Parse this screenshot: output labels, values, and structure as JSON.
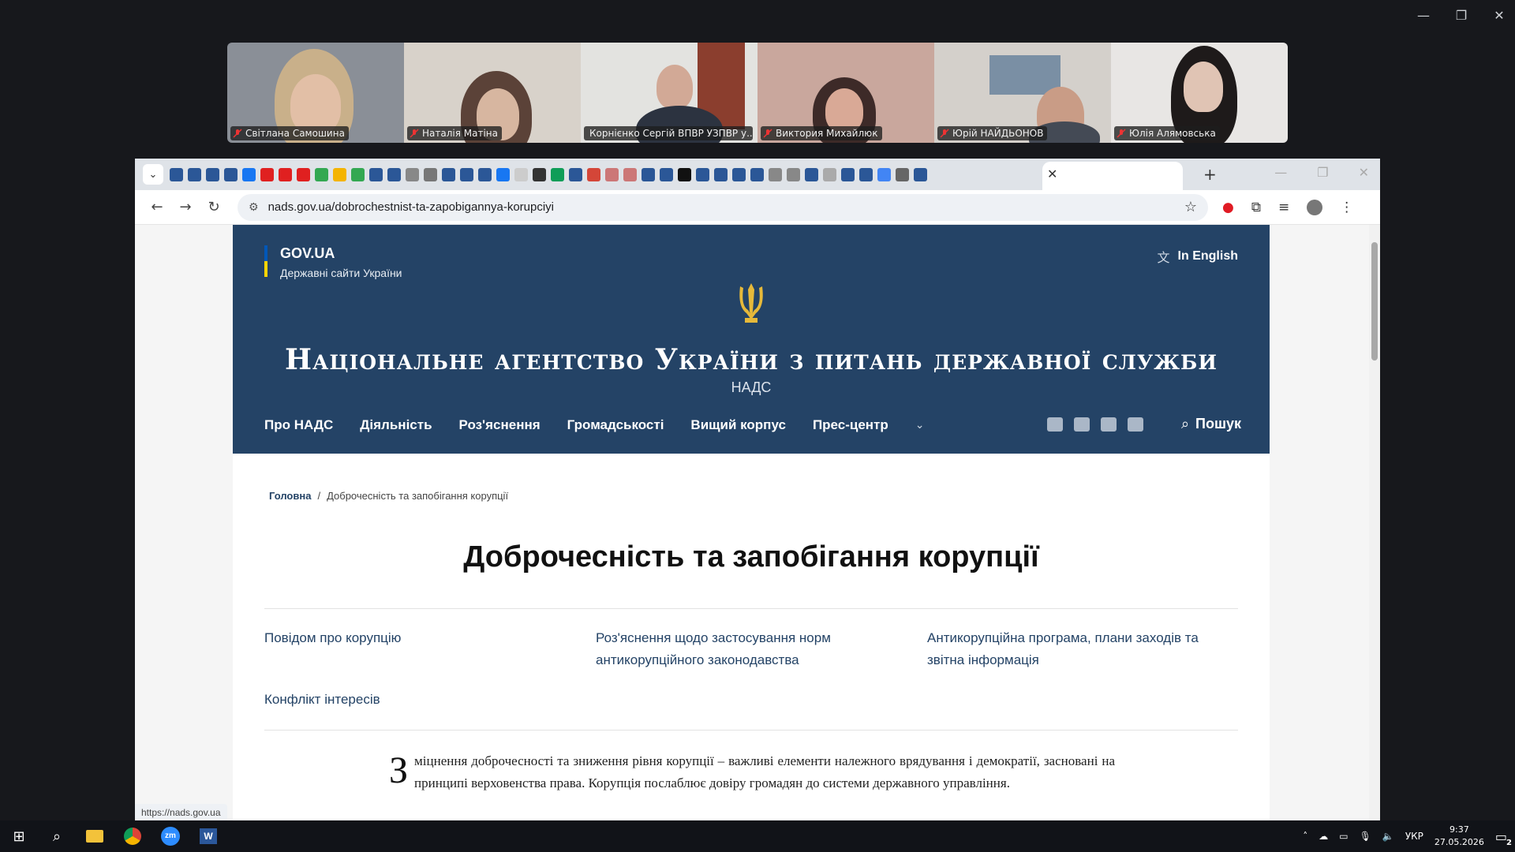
{
  "window_controls": [
    "—",
    "❐",
    "✕"
  ],
  "participants": [
    {
      "name": "Світлана Самошина",
      "bg": "#8a8f97"
    },
    {
      "name": "Наталія Матіна",
      "bg": "#c9c3bb"
    },
    {
      "name": "Корнієнко Сергій ВПВР УЗПВР у...",
      "bg": "#d9d9d6"
    },
    {
      "name": "Виктория Михайлюк",
      "bg": "#c6a59a"
    },
    {
      "name": "Юрій НАЙДЬОНОВ",
      "bg": "#cfcbc6"
    },
    {
      "name": "Юлія Алямовська",
      "bg": "#e6e4e3"
    }
  ],
  "browser": {
    "url": "nads.gov.ua/dobrochestnist-ta-zapobigannya-korupciyi",
    "status_url": "https://nads.gov.ua",
    "new_tab": "+",
    "close_tab": "✕"
  },
  "site": {
    "gov_title": "GOV.UA",
    "gov_subtitle": "Державні сайти України",
    "lang_link": "In English",
    "title": "Національне агентство України з питань державної служби",
    "abbr": "НАДС",
    "nav": [
      "Про НАДС",
      "Діяльність",
      "Роз'яснення",
      "Громадськості",
      "Вищий корпус",
      "Прес-центр"
    ],
    "search_label": "Пошук"
  },
  "breadcrumb": {
    "home": "Головна",
    "separator": "/",
    "current": "Доброчесність та запобігання корупції"
  },
  "page_title": "Доброчесність та запобігання корупції",
  "links": [
    "Повідом про корупцію",
    "Роз'яснення щодо застосування норм антикорупційного законодавства",
    "Антикорупційна програма, плани заходів та звітна інформація",
    "Конфлікт інтересів"
  ],
  "intro": {
    "dropcap": "З",
    "text": "міцнення доброчесності та зниження рівня корупції – важливі елементи належного врядування і демократії, засновані на принципі верховенства права. Корупція послаблює довіру громадян до системи державного управління."
  },
  "taskbar": {
    "language": "УКР",
    "time": "9:37",
    "date": "27.05.2026",
    "notifications": "2"
  },
  "colors": {
    "hero_bg": "#244366",
    "link": "#244366",
    "flag_blue": "#0057b8",
    "flag_yellow": "#ffd500"
  }
}
